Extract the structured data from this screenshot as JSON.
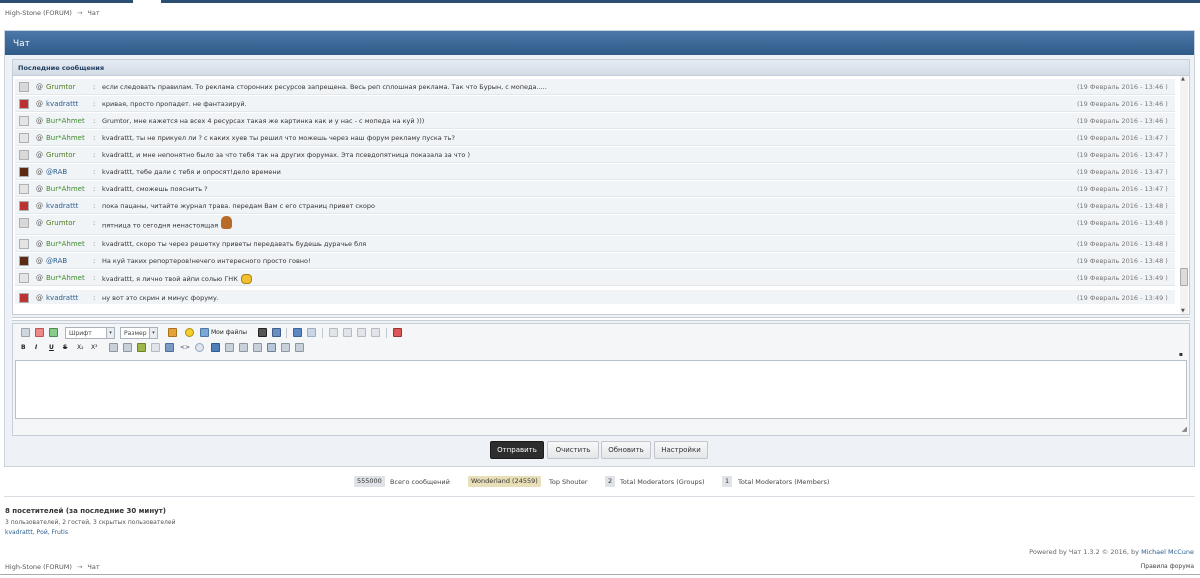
{
  "breadcrumb": {
    "site": "High-Stone (FORUM)",
    "separator": "→",
    "page": "Чат"
  },
  "panel": {
    "title": "Чат",
    "messages_header": "Последние сообщения"
  },
  "messages": [
    {
      "user": "Grumtor",
      "user_color": "#4f7a1e",
      "avatar": "grumtor",
      "text": "если следовать правилам. То реклама сторонних ресурсов запрещена. Весь реп сплошная реклама. Так что Бурын, с мопеда.....",
      "time": "(19 Февраль 2016 - 13:46 )"
    },
    {
      "user": "kvadrattt",
      "user_color": "#2a5d8f",
      "avatar": "kvadrattt",
      "text": "кривая, просто пропадет. не фантазируй.",
      "time": "(19 Февраль 2016 - 13:46 )"
    },
    {
      "user": "Bur*Ahmet",
      "user_color": "#3e8a2c",
      "avatar": "burahmet",
      "text": "Grumtor, мне кажется на всех 4 ресурсах такая же картинка как и у нас - с мопеда на куй )))",
      "time": "(19 Февраль 2016 - 13:46 )"
    },
    {
      "user": "Bur*Ahmet",
      "user_color": "#3e8a2c",
      "avatar": "burahmet",
      "text": "kvadrattt, ты не прикуел ли ? с каких хуев ты решил что можешь через наш форум рекламу пуска ть?",
      "time": "(19 Февраль 2016 - 13:47 )"
    },
    {
      "user": "Grumtor",
      "user_color": "#4f7a1e",
      "avatar": "grumtor",
      "text": "kvadrattt, и мне непонятно было за что тебя так на других форумах. Эта псевдопятница показала за что )",
      "time": "(19 Февраль 2016 - 13:47 )"
    },
    {
      "user": "@RAB",
      "user_color": "#2a5d8f",
      "avatar": "rab",
      "text": "kvadrattt, тебе дали с тебя и опросят!дело времени",
      "time": "(19 Февраль 2016 - 13:47 )"
    },
    {
      "user": "Bur*Ahmet",
      "user_color": "#3e8a2c",
      "avatar": "burahmet",
      "text": "kvadrattt, сможешь пояснить ?",
      "time": "(19 Февраль 2016 - 13:47 )"
    },
    {
      "user": "kvadrattt",
      "user_color": "#2a5d8f",
      "avatar": "kvadrattt",
      "text": "пока пацаны, читайте журнал трава. передам Вам с его страниц привет скоро",
      "time": "(19 Февраль 2016 - 13:48 )"
    },
    {
      "user": "Grumtor",
      "user_color": "#4f7a1e",
      "avatar": "grumtor",
      "text": "пятница то сегодня ненастоящая",
      "emoji": "bear",
      "time": "(19 Февраль 2016 - 13:48 )"
    },
    {
      "user": "Bur*Ahmet",
      "user_color": "#3e8a2c",
      "avatar": "burahmet",
      "text": "kvadrattt, скоро ты через решетку приветы передавать будешь дурачье бля",
      "time": "(19 Февраль 2016 - 13:48 )"
    },
    {
      "user": "@RAB",
      "user_color": "#2a5d8f",
      "avatar": "rab",
      "text": "На куй таких репортеров!нечего интересного просто говно!",
      "time": "(19 Февраль 2016 - 13:48 )"
    },
    {
      "user": "Bur*Ahmet",
      "user_color": "#3e8a2c",
      "avatar": "burahmet",
      "text": "kvadrattt, я лично твой айпи солью ГНК",
      "emoji": "fist",
      "time": "(19 Февраль 2016 - 13:49 )"
    },
    {
      "user": "kvadrattt",
      "user_color": "#2a5d8f",
      "avatar": "kvadrattt",
      "text": "ну вот это скрин и минус форуму.",
      "time": "(19 Февраль 2016 - 13:49 )"
    }
  ],
  "at_symbol": "@",
  "colon": ":",
  "editor": {
    "font_label": "Шрифт",
    "size_label": "Размер",
    "my_files": "Мои файлы",
    "format_buttons": [
      "B",
      "I",
      "U",
      "S",
      "X₂",
      "X²"
    ],
    "textarea_value": ""
  },
  "buttons": {
    "send": "Отправить",
    "clear": "Очистить",
    "refresh": "Обновить",
    "settings": "Настройки"
  },
  "stats": {
    "total_count": "555000",
    "total_label": "Всего сообщений",
    "top_user": "Wonderland (24559)",
    "top_label": "Top Shouter",
    "mod_groups_count": "2",
    "mod_groups_label": "Total Moderators (Groups)",
    "mod_members_count": "1",
    "mod_members_label": "Total Moderators (Members)"
  },
  "online": {
    "title": "8 посетителей (за последние 30 минут)",
    "subtitle": "3 пользователей, 2 гостей, 3 скрытых пользователей",
    "users": "kvadrattt, Рой, Frutis"
  },
  "footer": {
    "powered_prefix": "Powered by Чат 1.3.2 © 2016,  by ",
    "powered_author": "Michael McCune",
    "rules": "Правила форума"
  },
  "colors": {
    "header_blue": "#3a6796",
    "accent_dark": "#2d2d2d",
    "link_blue": "#2a5d8f"
  }
}
